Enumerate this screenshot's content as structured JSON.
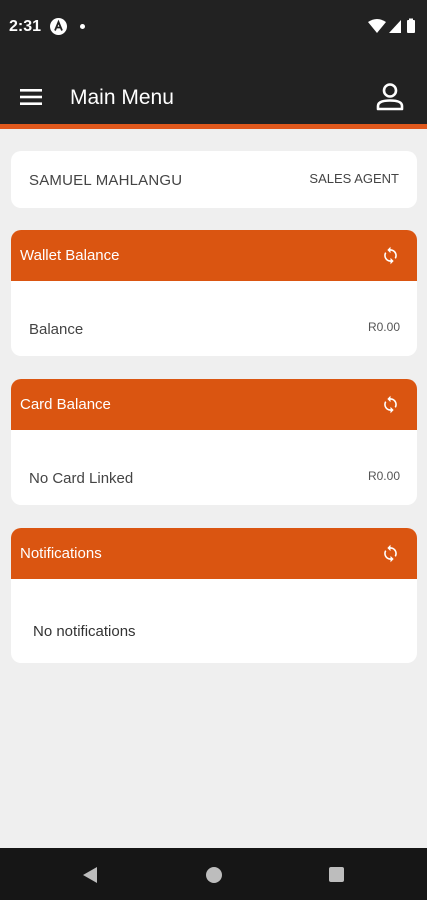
{
  "status_bar": {
    "time": "2:31"
  },
  "app_bar": {
    "title": "Main Menu"
  },
  "user": {
    "name": "SAMUEL MAHLANGU",
    "role": "SALES AGENT"
  },
  "wallet": {
    "title": "Wallet Balance",
    "label": "Balance",
    "amount": "R0.00"
  },
  "card_balance": {
    "title": "Card Balance",
    "label": "No Card Linked",
    "amount": "R0.00"
  },
  "notifications": {
    "title": "Notifications",
    "empty_text": "No notifications"
  },
  "colors": {
    "accent": "#da5511",
    "accent_line": "#e0581c",
    "app_bar": "#222222",
    "background": "#efefef"
  },
  "icons": [
    "hamburger-menu-icon",
    "profile-icon",
    "refresh-icon",
    "back-icon",
    "home-icon",
    "recents-icon"
  ]
}
